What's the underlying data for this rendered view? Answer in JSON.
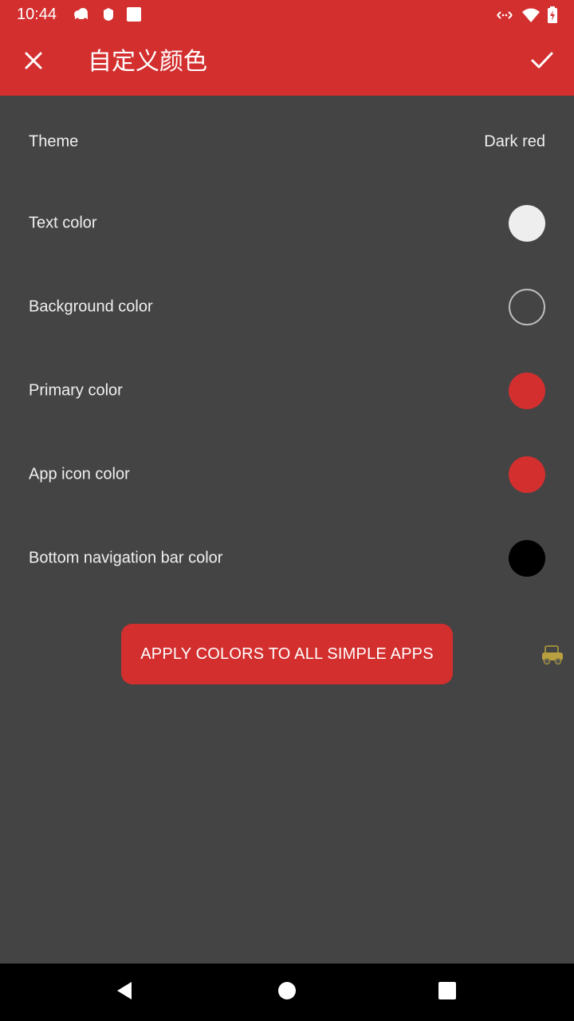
{
  "status_bar": {
    "time": "10:44",
    "left_icons": [
      "cloud-icon",
      "shield-icon",
      "square-icon"
    ],
    "right_icons": [
      "cast-icon",
      "wifi-icon",
      "battery-icon"
    ]
  },
  "app_bar": {
    "title": "自定义颜色",
    "close_icon": "close-icon",
    "confirm_icon": "check-icon"
  },
  "settings": {
    "theme": {
      "label": "Theme",
      "value": "Dark red"
    },
    "items": [
      {
        "label": "Text color",
        "color": "#eeeeee"
      },
      {
        "label": "Background color",
        "color": "#444444"
      },
      {
        "label": "Primary color",
        "color": "#d32f2f"
      },
      {
        "label": "App icon color",
        "color": "#d32f2f"
      },
      {
        "label": "Bottom navigation bar color",
        "color": "#000000"
      }
    ]
  },
  "apply_button": {
    "label": "APPLY COLORS TO ALL SIMPLE APPS"
  },
  "nav_bar": {
    "back_icon": "back-triangle-icon",
    "home_icon": "home-circle-icon",
    "recents_icon": "recents-square-icon"
  },
  "colors": {
    "accent": "#d32f2f",
    "background": "#444444",
    "text": "#f0f0f0"
  }
}
